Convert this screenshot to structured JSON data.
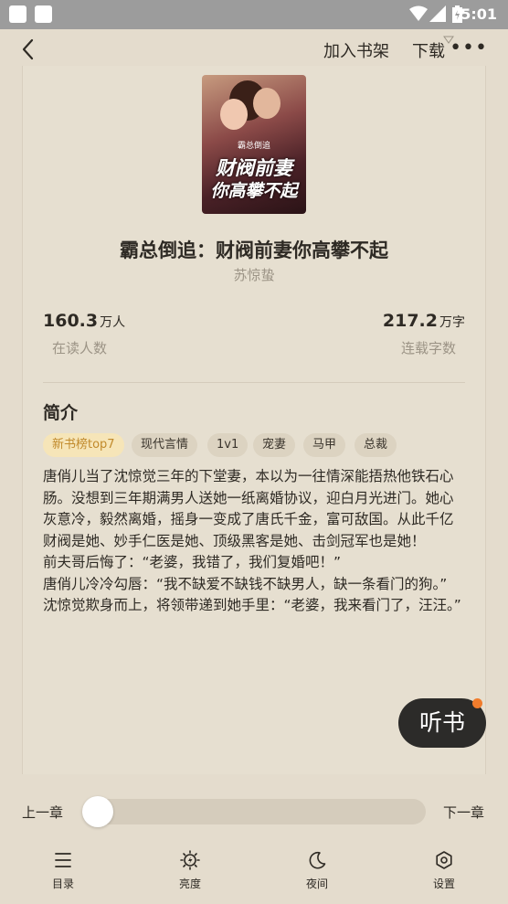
{
  "status_bar": {
    "time": "5:01"
  },
  "top_bar": {
    "add_shelf": "加入书架",
    "download": "下载",
    "more": "⋮"
  },
  "book": {
    "cover": {
      "tagline": "霸总倒追",
      "title_line1": "财阀前妻",
      "title_line2": "你高攀不起"
    },
    "title": "霸总倒追：财阀前妻你高攀不起",
    "author": "苏惊蛰"
  },
  "stats": {
    "readers": {
      "value": "160.3",
      "unit": "万人",
      "label": "在读人数"
    },
    "words": {
      "value": "217.2",
      "unit": "万字",
      "label": "连载字数"
    }
  },
  "intro": {
    "heading": "简介",
    "tags": [
      "新书榜top7",
      "现代言情",
      "1v1",
      "宠妻",
      "马甲",
      "总裁"
    ],
    "paragraphs": [
      "唐俏儿当了沈惊觉三年的下堂妻，本以为一往情深能捂热他铁石心肠。没想到三年期满男人送她一纸离婚协议，迎白月光进门。她心灰意冷，毅然离婚，摇身一变成了唐氏千金，富可敌国。从此千亿财阀是她、妙手仁医是她、顶级黑客是她、击剑冠军也是她！",
      "前夫哥后悔了：“老婆，我错了，我们复婚吧！”",
      "唐俏儿冷冷勾唇：“我不缺爱不缺钱不缺男人，缺一条看门的狗。”",
      "沈惊觉欺身而上，将领带递到她手里：“老婆，我来看门了，汪汪。”"
    ]
  },
  "listen_button": "听书",
  "chapter_nav": {
    "prev": "上一章",
    "next": "下一章",
    "progress": 0.0
  },
  "toolbar": {
    "catalog": "目录",
    "brightness": "亮度",
    "night": "夜间",
    "settings": "设置"
  }
}
